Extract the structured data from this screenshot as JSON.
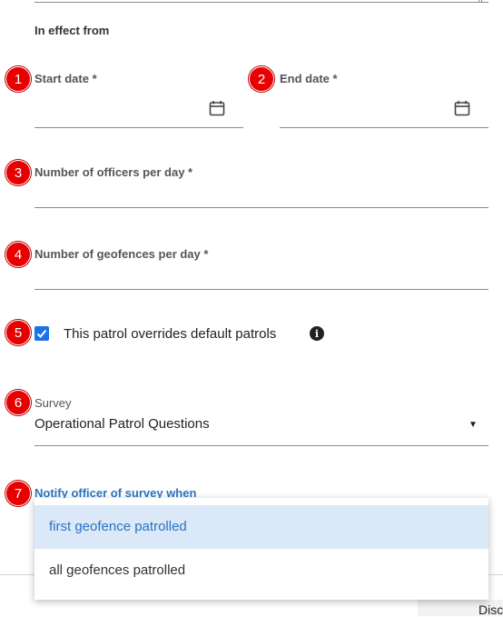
{
  "section_title": "In effect from",
  "fields": {
    "start_date": {
      "badge": "1",
      "label": "Start date *"
    },
    "end_date": {
      "badge": "2",
      "label": "End date *"
    },
    "officers": {
      "badge": "3",
      "label": "Number of officers per day *"
    },
    "geofences": {
      "badge": "4",
      "label": "Number of geofences per day *"
    }
  },
  "override": {
    "badge": "5",
    "label": "This patrol overrides default patrols",
    "checked": true
  },
  "survey": {
    "badge": "6",
    "label": "Survey",
    "value": "Operational Patrol Questions"
  },
  "notify": {
    "badge": "7",
    "label": "Notify officer of survey when",
    "options": [
      "first geofence patrolled",
      "all geofences patrolled"
    ],
    "selected_index": 0
  },
  "footer": {
    "discard_label": "Disc"
  },
  "colors": {
    "accent": "#1a73e8",
    "badge": "#e60000",
    "link": "#2a74c4"
  }
}
